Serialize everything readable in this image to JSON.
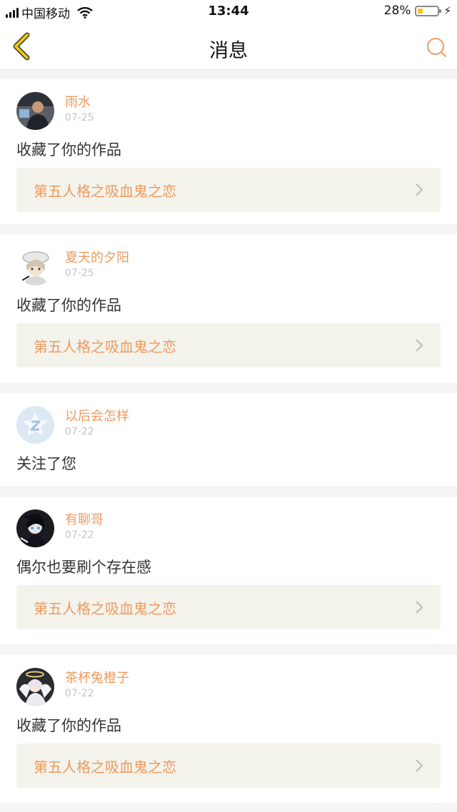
{
  "status_bar": {
    "carrier": "中国移动",
    "time": "13:44",
    "battery": "28%",
    "battery_level": 0.28
  },
  "nav": {
    "title": "消息",
    "back_icon": "chevron-left-icon",
    "search_icon": "search-icon"
  },
  "colors": {
    "accent": "#ef9a5e",
    "date": "#c4c4c4",
    "work_bg": "#f3f3ec",
    "page_bg": "#f6f5f4"
  },
  "messages": [
    {
      "user": "雨水",
      "date": "07-25",
      "text": "收藏了你的作品",
      "work": "第五人格之吸血鬼之恋",
      "avatar": "avatar-photo-man"
    },
    {
      "user": "夏天的夕阳",
      "date": "07-25",
      "text": "收藏了你的作品",
      "work": "第五人格之吸血鬼之恋",
      "avatar": "avatar-anime-hat"
    },
    {
      "user": "以后会怎样",
      "date": "07-22",
      "text": "关注了您",
      "work": "",
      "avatar": "avatar-default-qq"
    },
    {
      "user": "有聊哥",
      "date": "07-22",
      "text": "偶尔也要刷个存在感",
      "work": "第五人格之吸血鬼之恋",
      "avatar": "avatar-anime-dark"
    },
    {
      "user": "茶杯兔橙子",
      "date": "07-22",
      "text": "收藏了你的作品",
      "work": "第五人格之吸血鬼之恋",
      "avatar": "avatar-anime-angel"
    }
  ]
}
